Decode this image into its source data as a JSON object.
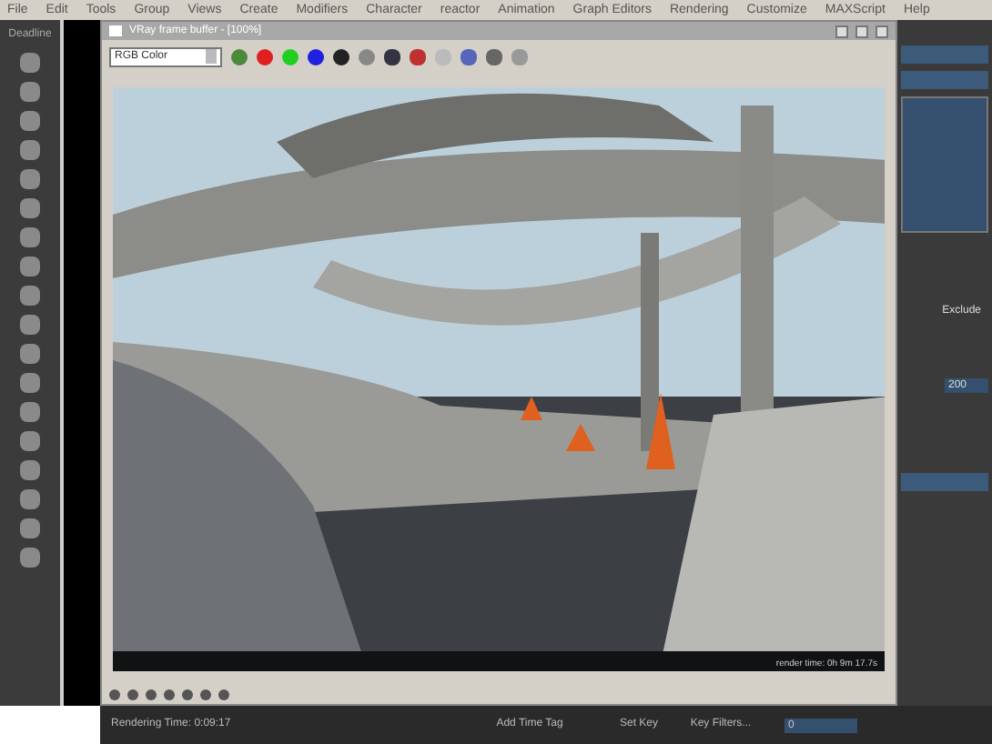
{
  "menu": [
    "File",
    "Edit",
    "Tools",
    "Group",
    "Views",
    "Create",
    "Modifiers",
    "Character",
    "reactor",
    "Animation",
    "Graph Editors",
    "Rendering",
    "Customize",
    "MAXScript",
    "Help"
  ],
  "left_panel": {
    "label": "Deadline"
  },
  "frame_buffer": {
    "title": "VRay frame buffer - [100%]",
    "channel": "RGB Color",
    "render_stamp": "render time: 0h 9m 17.7s"
  },
  "right_panel": {
    "button": "Exclude",
    "spinner": "200"
  },
  "status_bar": {
    "rendering_time": "Rendering Time: 0:09:17",
    "add_time_tag": "Add Time Tag",
    "set_key": "Set Key",
    "key_filters": "Key Filters...",
    "frame": "0"
  }
}
